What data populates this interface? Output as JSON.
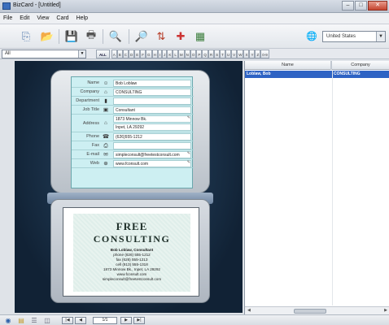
{
  "window": {
    "title": "BizCard - [Untitled]"
  },
  "menu": [
    "File",
    "Edit",
    "View",
    "Card",
    "Help"
  ],
  "toolbar": {
    "country": "United States"
  },
  "filter": {
    "selected": "All",
    "all_label": "ALL",
    "letters": [
      "A",
      "B",
      "C",
      "D",
      "E",
      "F",
      "G",
      "H",
      "I",
      "J",
      "K",
      "L",
      "M",
      "N",
      "O",
      "P",
      "Q",
      "R",
      "S",
      "T",
      "U",
      "V",
      "W",
      "X",
      "Y",
      "Z",
      "0-9"
    ]
  },
  "card": {
    "name": {
      "label": "Name",
      "value": "Bob Loblaw"
    },
    "company": {
      "label": "Company",
      "value": "CONSULTING"
    },
    "department": {
      "label": "Department",
      "value": ""
    },
    "job_title": {
      "label": "Job Title",
      "value": "Consultant"
    },
    "address": {
      "label": "Address",
      "line1": "1873 Minnow Bk.",
      "line2": "Inpet, LA 29292"
    },
    "phone": {
      "label": "Phone",
      "value": "(626)555-1212"
    },
    "fax": {
      "label": "Fax",
      "value": ""
    },
    "email": {
      "label": "E-mail",
      "value": "simpleconsult@freetestconsult.com"
    },
    "web": {
      "label": "Web",
      "value": "www.fconsult.com"
    }
  },
  "scan": {
    "line1": "FREE",
    "line2": "CONSULTING",
    "name": "Bob Loblaw, Consultant",
    "phone": "phone (626) 555-1212",
    "fax": "fax (626) 555-1213",
    "cell": "cell (813) 555-1318",
    "address": "1873 Minnow Bk., Inpet, LA 29292",
    "web": "www.fconsult.com",
    "email": "simpleconsult@freetestconsult.com"
  },
  "list": {
    "columns": [
      "Name",
      "Company"
    ],
    "rows": [
      {
        "name": "Loblaw, Bob",
        "company": "CONSULTING"
      }
    ]
  },
  "status": {
    "count": "1/1"
  },
  "icons": {
    "app": "app-icon",
    "search": "magnifier-icon",
    "world": "globe-icon"
  }
}
